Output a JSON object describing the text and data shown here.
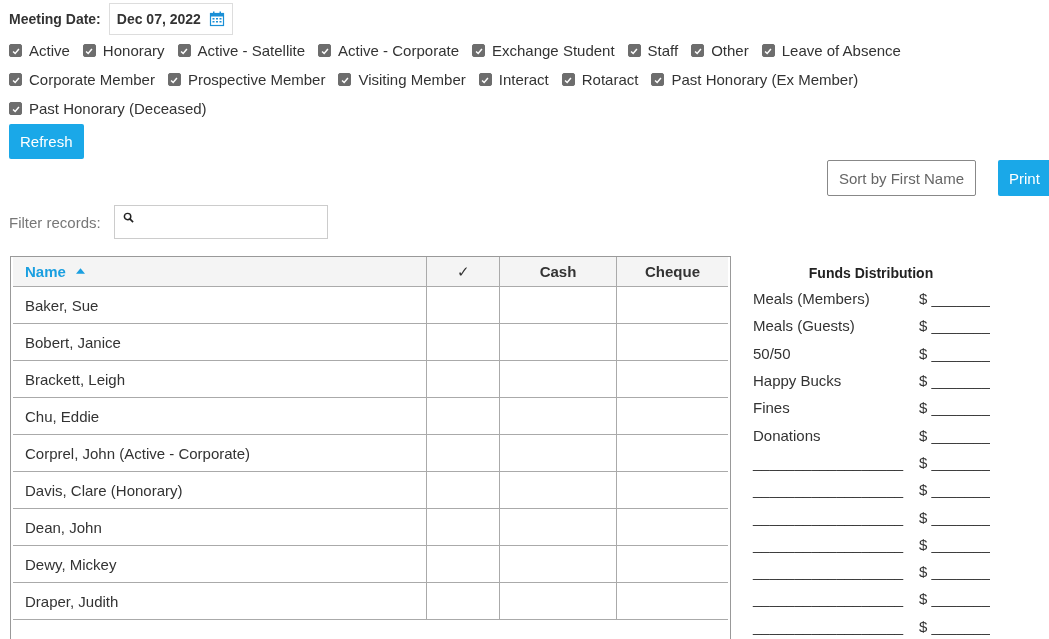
{
  "meeting_date": {
    "label": "Meeting Date:",
    "value": "Dec 07, 2022"
  },
  "filter_rows": [
    [
      {
        "label": "Active",
        "checked": true
      },
      {
        "label": "Honorary",
        "checked": true
      },
      {
        "label": "Active - Satellite",
        "checked": true
      },
      {
        "label": "Active - Corporate",
        "checked": true
      },
      {
        "label": "Exchange Student",
        "checked": true
      },
      {
        "label": "Staff",
        "checked": true
      },
      {
        "label": "Other",
        "checked": true
      },
      {
        "label": "Leave of Absence",
        "checked": true
      }
    ],
    [
      {
        "label": "Corporate Member",
        "checked": true
      },
      {
        "label": "Prospective Member",
        "checked": true
      },
      {
        "label": "Visiting Member",
        "checked": true
      },
      {
        "label": "Interact",
        "checked": true
      },
      {
        "label": "Rotaract",
        "checked": true
      },
      {
        "label": "Past Honorary (Ex Member)",
        "checked": true
      }
    ],
    [
      {
        "label": "Past Honorary (Deceased)",
        "checked": true
      }
    ]
  ],
  "refresh_button": "Refresh",
  "sort_button": "Sort by First Name",
  "print_button": "Print",
  "filter": {
    "label": "Filter records:"
  },
  "table": {
    "columns": [
      {
        "label": "Name",
        "sorted": true
      },
      {
        "label": "✓",
        "sorted": false
      },
      {
        "label": "Cash",
        "sorted": false
      },
      {
        "label": "Cheque",
        "sorted": false
      }
    ],
    "rows": [
      "Baker, Sue",
      "Bobert, Janice",
      "Brackett, Leigh",
      "Chu, Eddie",
      "Corprel, John (Active - Corporate)",
      "Davis, Clare (Honorary)",
      "Dean, John",
      "Dewy, Mickey",
      "Draper, Judith"
    ]
  },
  "funds": {
    "title": "Funds Distribution",
    "rows": [
      {
        "label": "Meals (Members)",
        "amount": "$ _______"
      },
      {
        "label": "Meals (Guests)",
        "amount": "$ _______"
      },
      {
        "label": "50/50",
        "amount": "$ _______"
      },
      {
        "label": "Happy Bucks",
        "amount": "$ _______"
      },
      {
        "label": "Fines",
        "amount": "$ _______"
      },
      {
        "label": "Donations",
        "amount": "$ _______"
      },
      {
        "label": "__________________",
        "amount": "$ _______"
      },
      {
        "label": "__________________",
        "amount": "$ _______"
      },
      {
        "label": "__________________",
        "amount": "$ _______"
      },
      {
        "label": "__________________",
        "amount": "$ _______"
      },
      {
        "label": "__________________",
        "amount": "$ _______"
      },
      {
        "label": "__________________",
        "amount": "$ _______"
      },
      {
        "label": "__________________",
        "amount": "$ _______"
      }
    ]
  }
}
